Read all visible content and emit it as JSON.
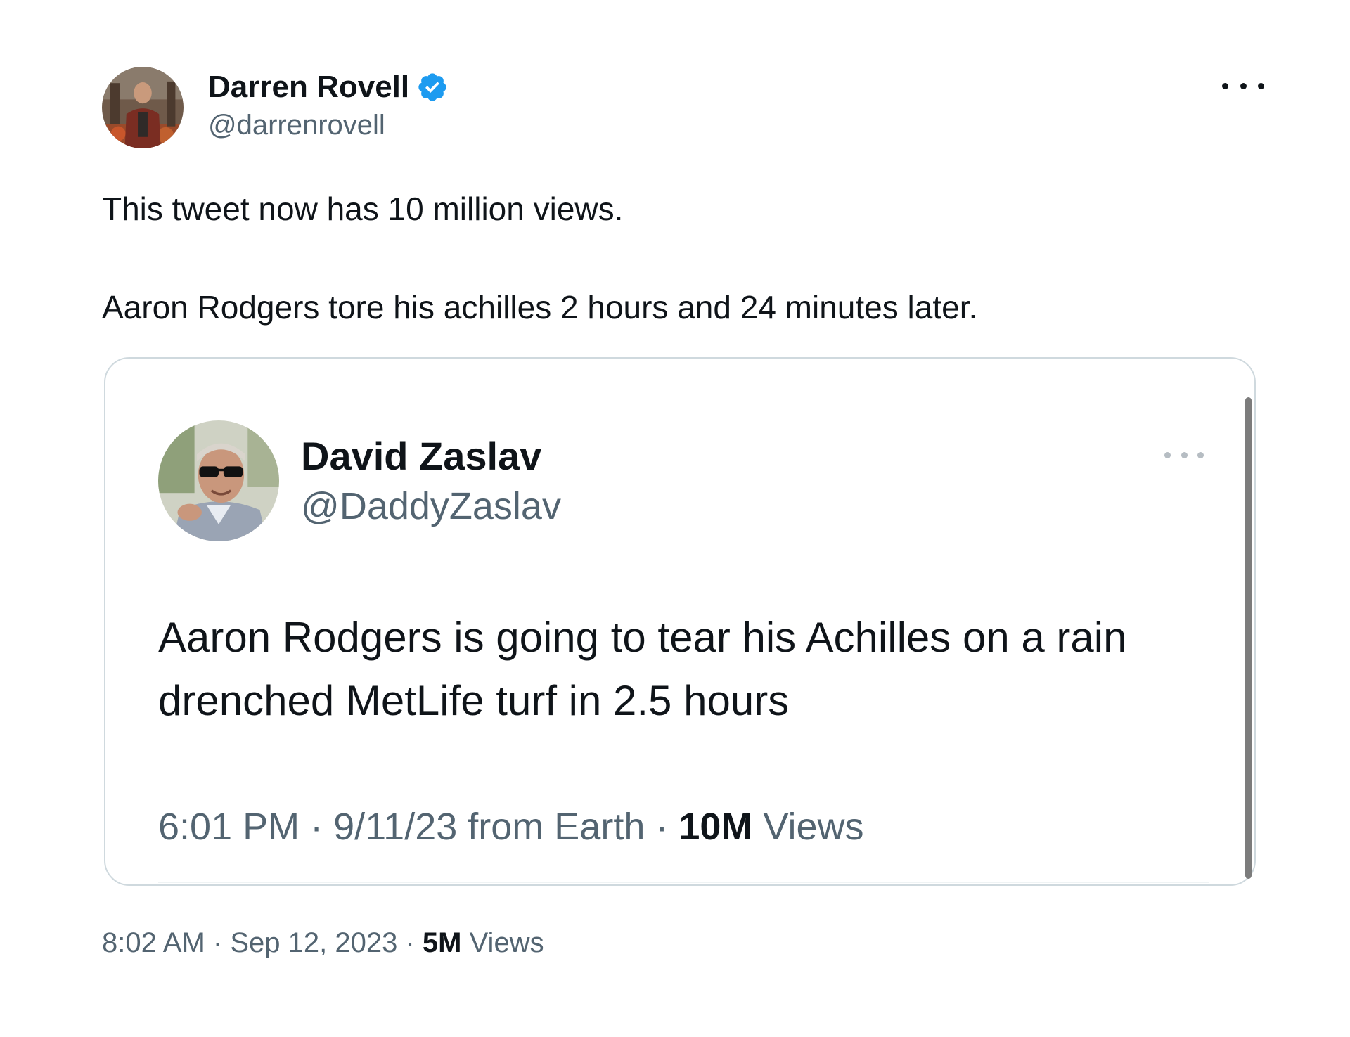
{
  "author": {
    "display_name": "Darren Rovell",
    "handle": "@darrenrovell",
    "verified": true,
    "verified_icon": "verified-badge-icon",
    "avatar_icon": "avatar-photo"
  },
  "more_icon": "more-options-icon",
  "text": {
    "line1": "This tweet now has 10 million views.",
    "line2": "Aaron Rodgers tore his achilles 2 hours and 24 minutes later."
  },
  "quoted": {
    "display_name": "David Zaslav",
    "handle": "@DaddyZaslav",
    "avatar_icon": "avatar-photo",
    "text_line1": "Aaron Rodgers is going to tear his Achilles on a rain",
    "text_line2": "drenched MetLife turf in 2.5 hours",
    "time": "6:01 PM",
    "date": "9/11/23 from Earth",
    "views_count": "10M",
    "views_label": "Views"
  },
  "meta": {
    "time": "8:02 AM",
    "date": "Sep 12, 2023",
    "views_count": "5M",
    "views_label": "Views"
  },
  "colors": {
    "text": "#0f1419",
    "secondary": "#536471",
    "verified_blue": "#1d9bf0",
    "border": "#cfd9de"
  }
}
